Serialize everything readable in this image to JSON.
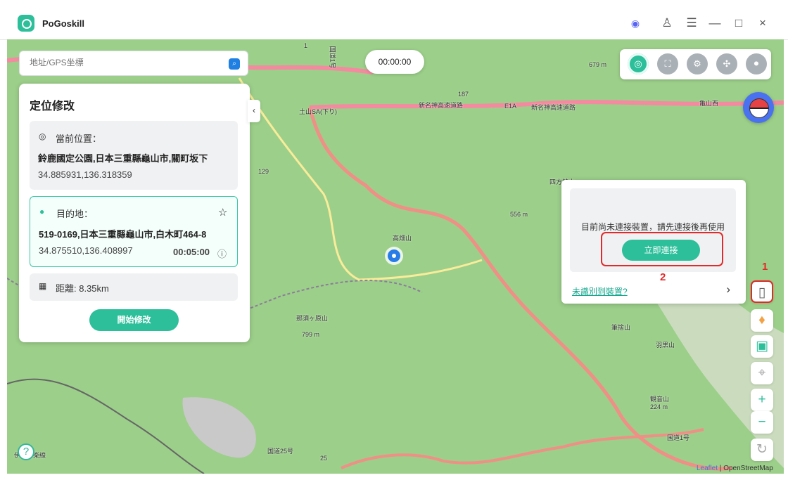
{
  "app": {
    "title": "PoGoskill"
  },
  "window_controls": {
    "discord": "◉",
    "account": "♙",
    "menu": "☰",
    "minimize": "—",
    "maximize": "□",
    "close": "×"
  },
  "search": {
    "placeholder": "地址/GPS坐標",
    "button_icon": "⌕"
  },
  "timer": "00:00:00",
  "panel": {
    "title": "定位修改",
    "current_label": "當前位置：",
    "current_place": "鈴鹿國定公園,日本三重縣龜山市,關町坂下",
    "current_coords": "34.885931,136.318359",
    "destination_label": "目的地：",
    "destination_place": "519-0169,日本三重縣龜山市,白木町464-8",
    "destination_coords": "34.875510,136.408997",
    "duration": "00:05:00",
    "distance_label": "距離: 8.35km",
    "start_button": "開始修改",
    "collapse_icon": "‹"
  },
  "mode_icons": [
    "◎",
    "⛶",
    "⚙",
    "✣",
    "⚫"
  ],
  "popup": {
    "message": "目前尚未連接裝置，請先連接後再使用",
    "connect_button": "立即連接",
    "step_number": "2",
    "unrecognized_link": "未識別到裝置?",
    "arrow": "›"
  },
  "sidebar": {
    "step_number": "1",
    "device_icon": "▯",
    "shirt_icon": "♦",
    "folder_icon": "▣",
    "locate_icon": "⌖",
    "zoom_in": "+",
    "zoom_out": "−",
    "reset_icon": "↻"
  },
  "map": {
    "labels": [
      "1",
      "国道1号",
      "679 m",
      "187",
      "E1A",
      "新名神高速道路",
      "土山SA(下り)",
      "新名神高速道路",
      "129",
      "四方替山",
      "556 m",
      "高畑山",
      "那須ヶ原山",
      "799 m",
      "筆捨山",
      "羽黒山",
      "観音山",
      "224 m",
      "国道1号",
      "国道25号",
      "25",
      "伊賀信楽線",
      "亀山西"
    ],
    "attribution": "Leaflet",
    "attribution_provider": "OpenStreetMap",
    "help": "?"
  },
  "colors": {
    "accent": "#2cbf9a",
    "alert": "#e22a2a",
    "link": "#13a78d",
    "map": "#9ccf8a"
  }
}
